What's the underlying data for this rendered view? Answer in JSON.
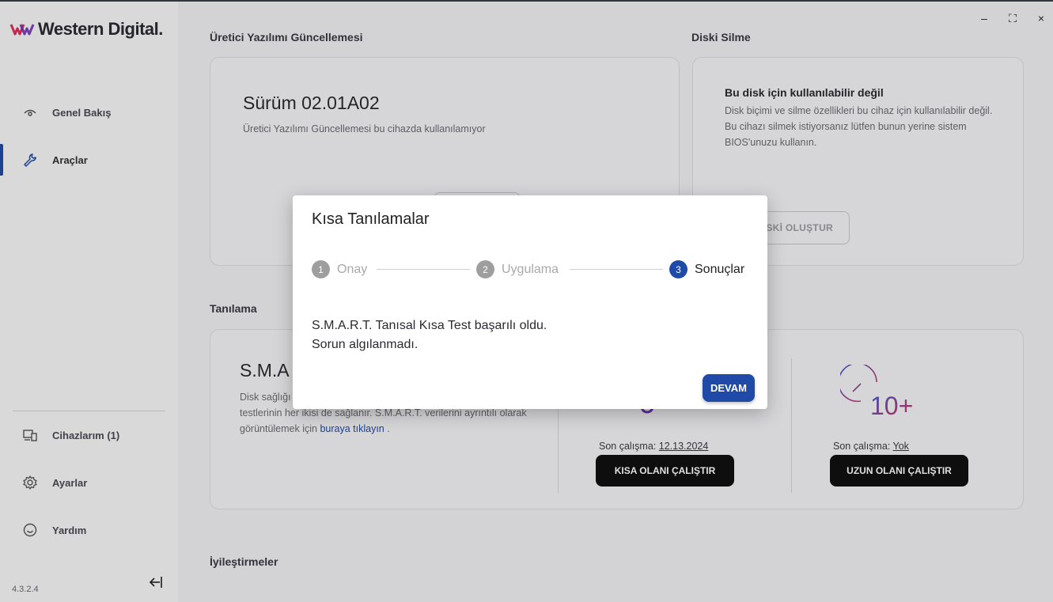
{
  "app": {
    "logo_text": "Western Digital.",
    "version": "4.3.2.4"
  },
  "sidebar": {
    "items": [
      {
        "label": "Genel Bakış",
        "icon": "eye-icon"
      },
      {
        "label": "Araçlar",
        "icon": "wrench-icon"
      },
      {
        "label": "Cihazlarım (1)",
        "icon": "devices-icon"
      },
      {
        "label": "Ayarlar",
        "icon": "gear-icon"
      },
      {
        "label": "Yardım",
        "icon": "help-icon"
      }
    ]
  },
  "firmware": {
    "section_title": "Üretici Yazılımı Güncellemesi",
    "version_text": "Sürüm 02.01A02",
    "note": "Üretici Yazılımı Güncellemesi bu cihazda kullanılamıyor"
  },
  "wipe": {
    "section_title": "Diski Silme",
    "title": "Bu disk için kullanılabilir değil",
    "description": "Disk biçimi ve silme özellikleri bu cihaz için kullanılabilir değil. Bu cihazı silmek istiyorsanız lütfen bunun yerine sistem BIOS'unuzu kullanın.",
    "button_label": "DİSKİ OLUŞTUR"
  },
  "diagnostics": {
    "section_title": "Tanılama",
    "title": "S.M.A",
    "description_a": "Disk sağlığı",
    "description_b": "tanılama testi çalıştırın. Kısa ve uzun tanılama testlerinin her ikisi de sağlanır. S.M.A.R.T. verilerini ayrıntılı olarak görüntülemek için ",
    "link_text": "buraya tıklayın",
    "description_end": " .",
    "short": {
      "last_run_label": "Son çalışma:",
      "last_run_value": "12.13.2024",
      "button_label": "KISA OLANI ÇALIŞTIR"
    },
    "long": {
      "last_run_label": "Son çalışma:",
      "last_run_value": "Yok",
      "button_label": "UZUN OLANI ÇALIŞTIR",
      "icon_text": "10+"
    }
  },
  "improvements": {
    "section_title": "İyileştirmeler"
  },
  "modal": {
    "title": "Kısa Tanılamalar",
    "steps": [
      {
        "num": "1",
        "label": "Onay"
      },
      {
        "num": "2",
        "label": "Uygulama"
      },
      {
        "num": "3",
        "label": "Sonuçlar"
      }
    ],
    "message_line1": "S.M.A.R.T. Tanısal Kısa Test başarılı oldu.",
    "message_line2": "Sorun algılanmadı.",
    "continue_label": "DEVAM"
  },
  "window": {
    "minimize": "–",
    "maximize": "⛶",
    "close": "×"
  },
  "colors": {
    "accent": "#1f4aa8",
    "dark_button": "#111111"
  }
}
